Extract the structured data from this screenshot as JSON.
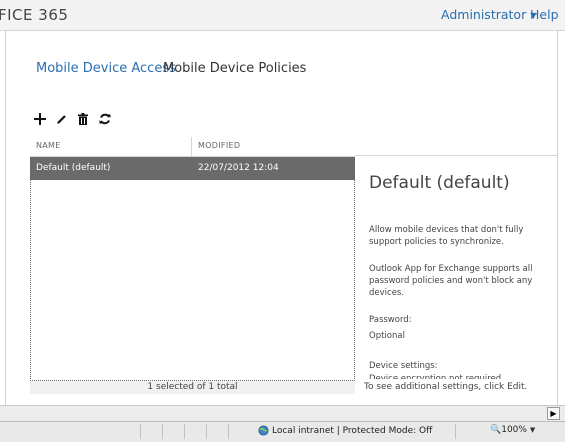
{
  "header": {
    "brand": "FICE 365",
    "user_label": "Administrator",
    "help_label": "Help"
  },
  "breadcrumb": {
    "link": "Mobile Device Access",
    "current": "Mobile Device Policies"
  },
  "toolbar": {
    "icons": [
      "add-icon",
      "edit-icon",
      "delete-icon",
      "refresh-icon"
    ]
  },
  "table": {
    "columns": [
      "NAME",
      "MODIFIED"
    ],
    "rows": [
      {
        "name": "Default (default)",
        "modified": "22/07/2012 12:04"
      }
    ],
    "footer": "1 selected of 1 total"
  },
  "details": {
    "title": "Default (default)",
    "para1": "Allow mobile devices that don't fully support policies to synchronize.",
    "para2": "Outlook App for Exchange supports all password policies and won't block any devices.",
    "password_label": "Password:",
    "password_value": "Optional",
    "device_settings_label": "Device settings:",
    "device_encryption": "Device encryption not required",
    "tip": "To see additional settings, click Edit."
  },
  "statusbar": {
    "zone": "Local intranet | Protected Mode: Off",
    "zoom": "100%"
  },
  "colors": {
    "accent": "#2a6eb0",
    "selected_row": "#6a6a6a"
  }
}
